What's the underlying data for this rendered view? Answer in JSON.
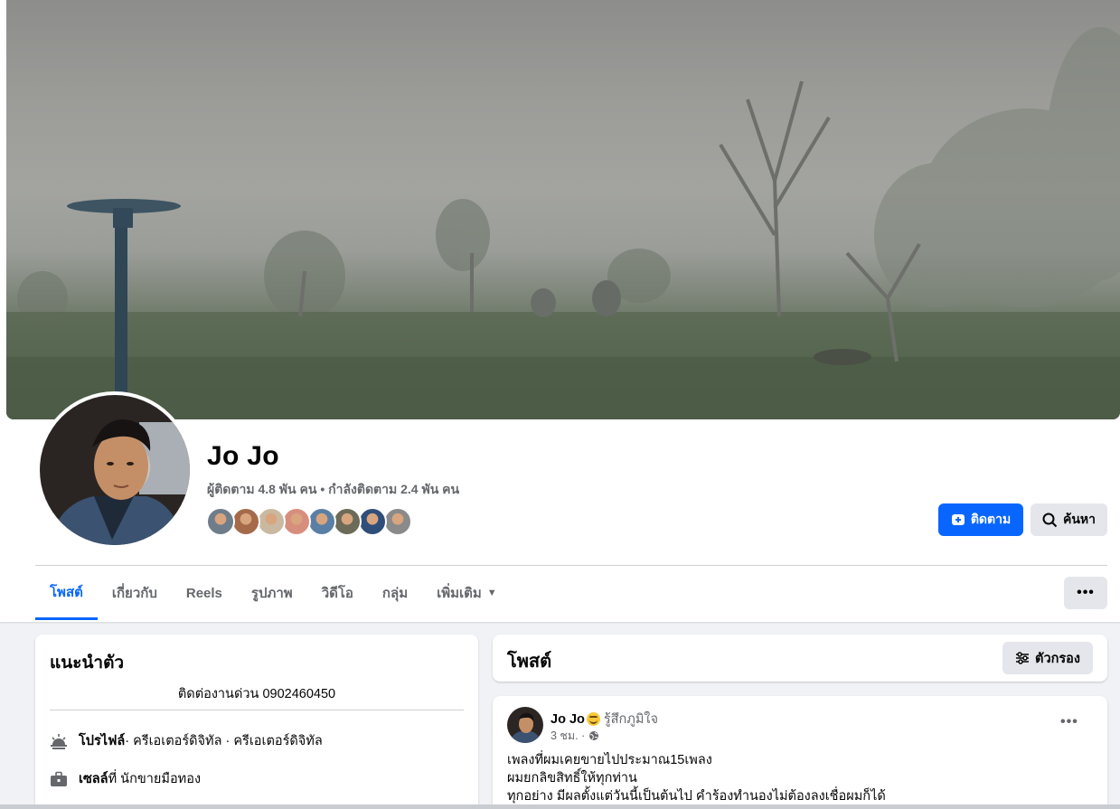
{
  "profile": {
    "name": "Jo Jo",
    "stats": "ผู้ติดตาม 4.8 พัน คน • กำลังติดตาม 2.4 พัน คน",
    "friend_avatars": [
      "#6f7d8a",
      "#a56a4a",
      "#c9b9a0",
      "#d88e7d",
      "#5a7fa4",
      "#6c6a58",
      "#2f4f7a",
      "#8a8a8a"
    ]
  },
  "actions": {
    "follow_label": "ติดตาม",
    "search_label": "ค้นหา",
    "more_label": "•••"
  },
  "tabs": [
    {
      "label": "โพสต์",
      "active": true
    },
    {
      "label": "เกี่ยวกับ",
      "active": false
    },
    {
      "label": "Reels",
      "active": false
    },
    {
      "label": "รูปภาพ",
      "active": false
    },
    {
      "label": "วิดีโอ",
      "active": false
    },
    {
      "label": "กลุ่ม",
      "active": false
    },
    {
      "label": "เพิ่มเติม",
      "active": false
    }
  ],
  "intro": {
    "title": "แนะนำตัว",
    "bio": "ติดต่องานด่วน 0902460450",
    "profile_label": "โปรไฟล์",
    "profile_value": " · ครีเอเตอร์ดิจิทัล · ครีเอเตอร์ดิจิทัล",
    "work_label": "เซลล์",
    "work_value": " ที่ นักขายมือทอง"
  },
  "posts_section": {
    "title": "โพสต์",
    "filter_label": "ตัวกรอง"
  },
  "post": {
    "author": "Jo Jo",
    "feeling": "รู้สึกภูมิใจ",
    "time": "3 ชม. ·",
    "lines": [
      "เพลงที่ผมเคยขายไปประมาณ15เพลง",
      "ผมยกลิขสิทธิ์ให้ทุกท่าน",
      "ทุกอย่าง  มีผลตั้งแต่วันนี้เป็นต้นไป คำร้องทำนองไม่ต้องลงเชื่อผมก็ได้"
    ]
  },
  "colors": {
    "accent": "#0866ff",
    "secondary_button": "#e4e6eb",
    "muted_text": "#65676b",
    "page_bg": "#f0f2f5"
  },
  "icons": [
    "add-friend-icon",
    "search-icon",
    "caret-down-icon",
    "filter-icon",
    "profile-info-icon",
    "briefcase-icon",
    "globe-icon",
    "more-dots-icon"
  ]
}
